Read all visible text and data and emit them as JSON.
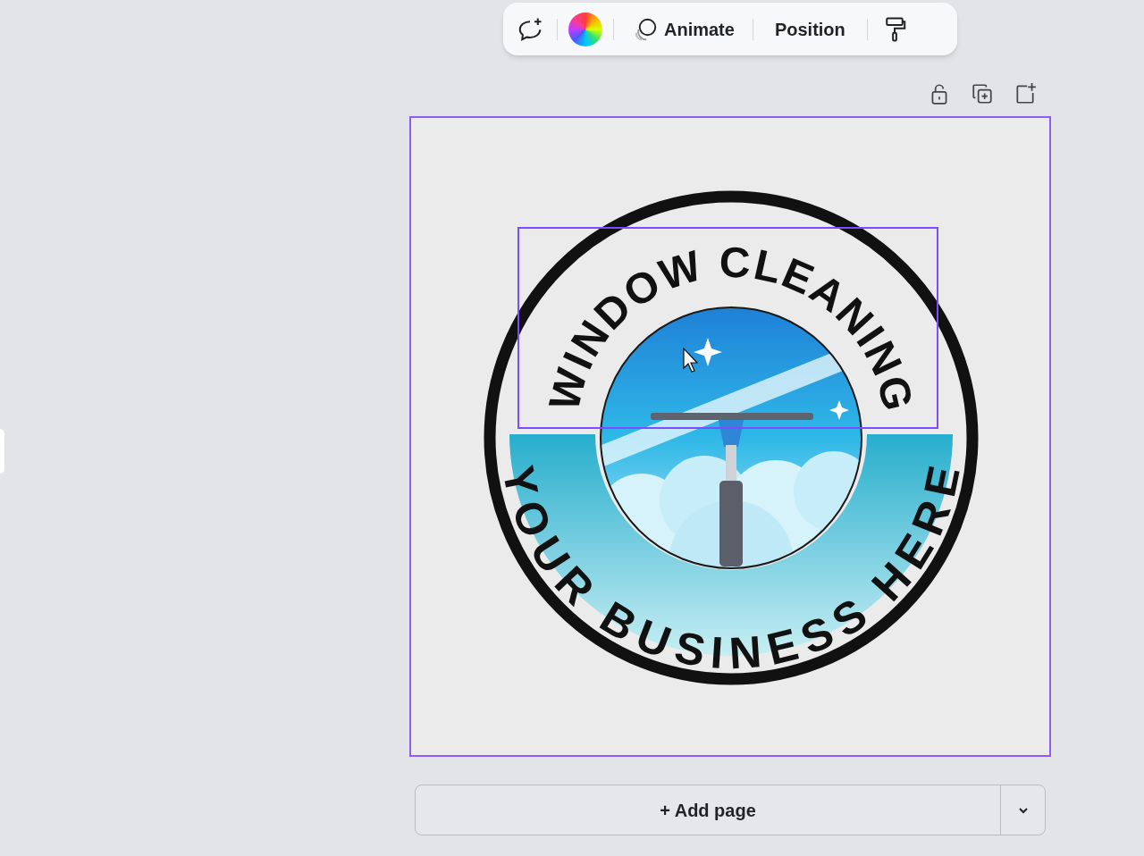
{
  "toolbar": {
    "animate_label": "Animate",
    "position_label": "Position"
  },
  "logo": {
    "top_text": "WINDOW CLEANING",
    "bottom_text": "YOUR BUSINESS HERE"
  },
  "add_page": {
    "label": "+ Add page"
  }
}
